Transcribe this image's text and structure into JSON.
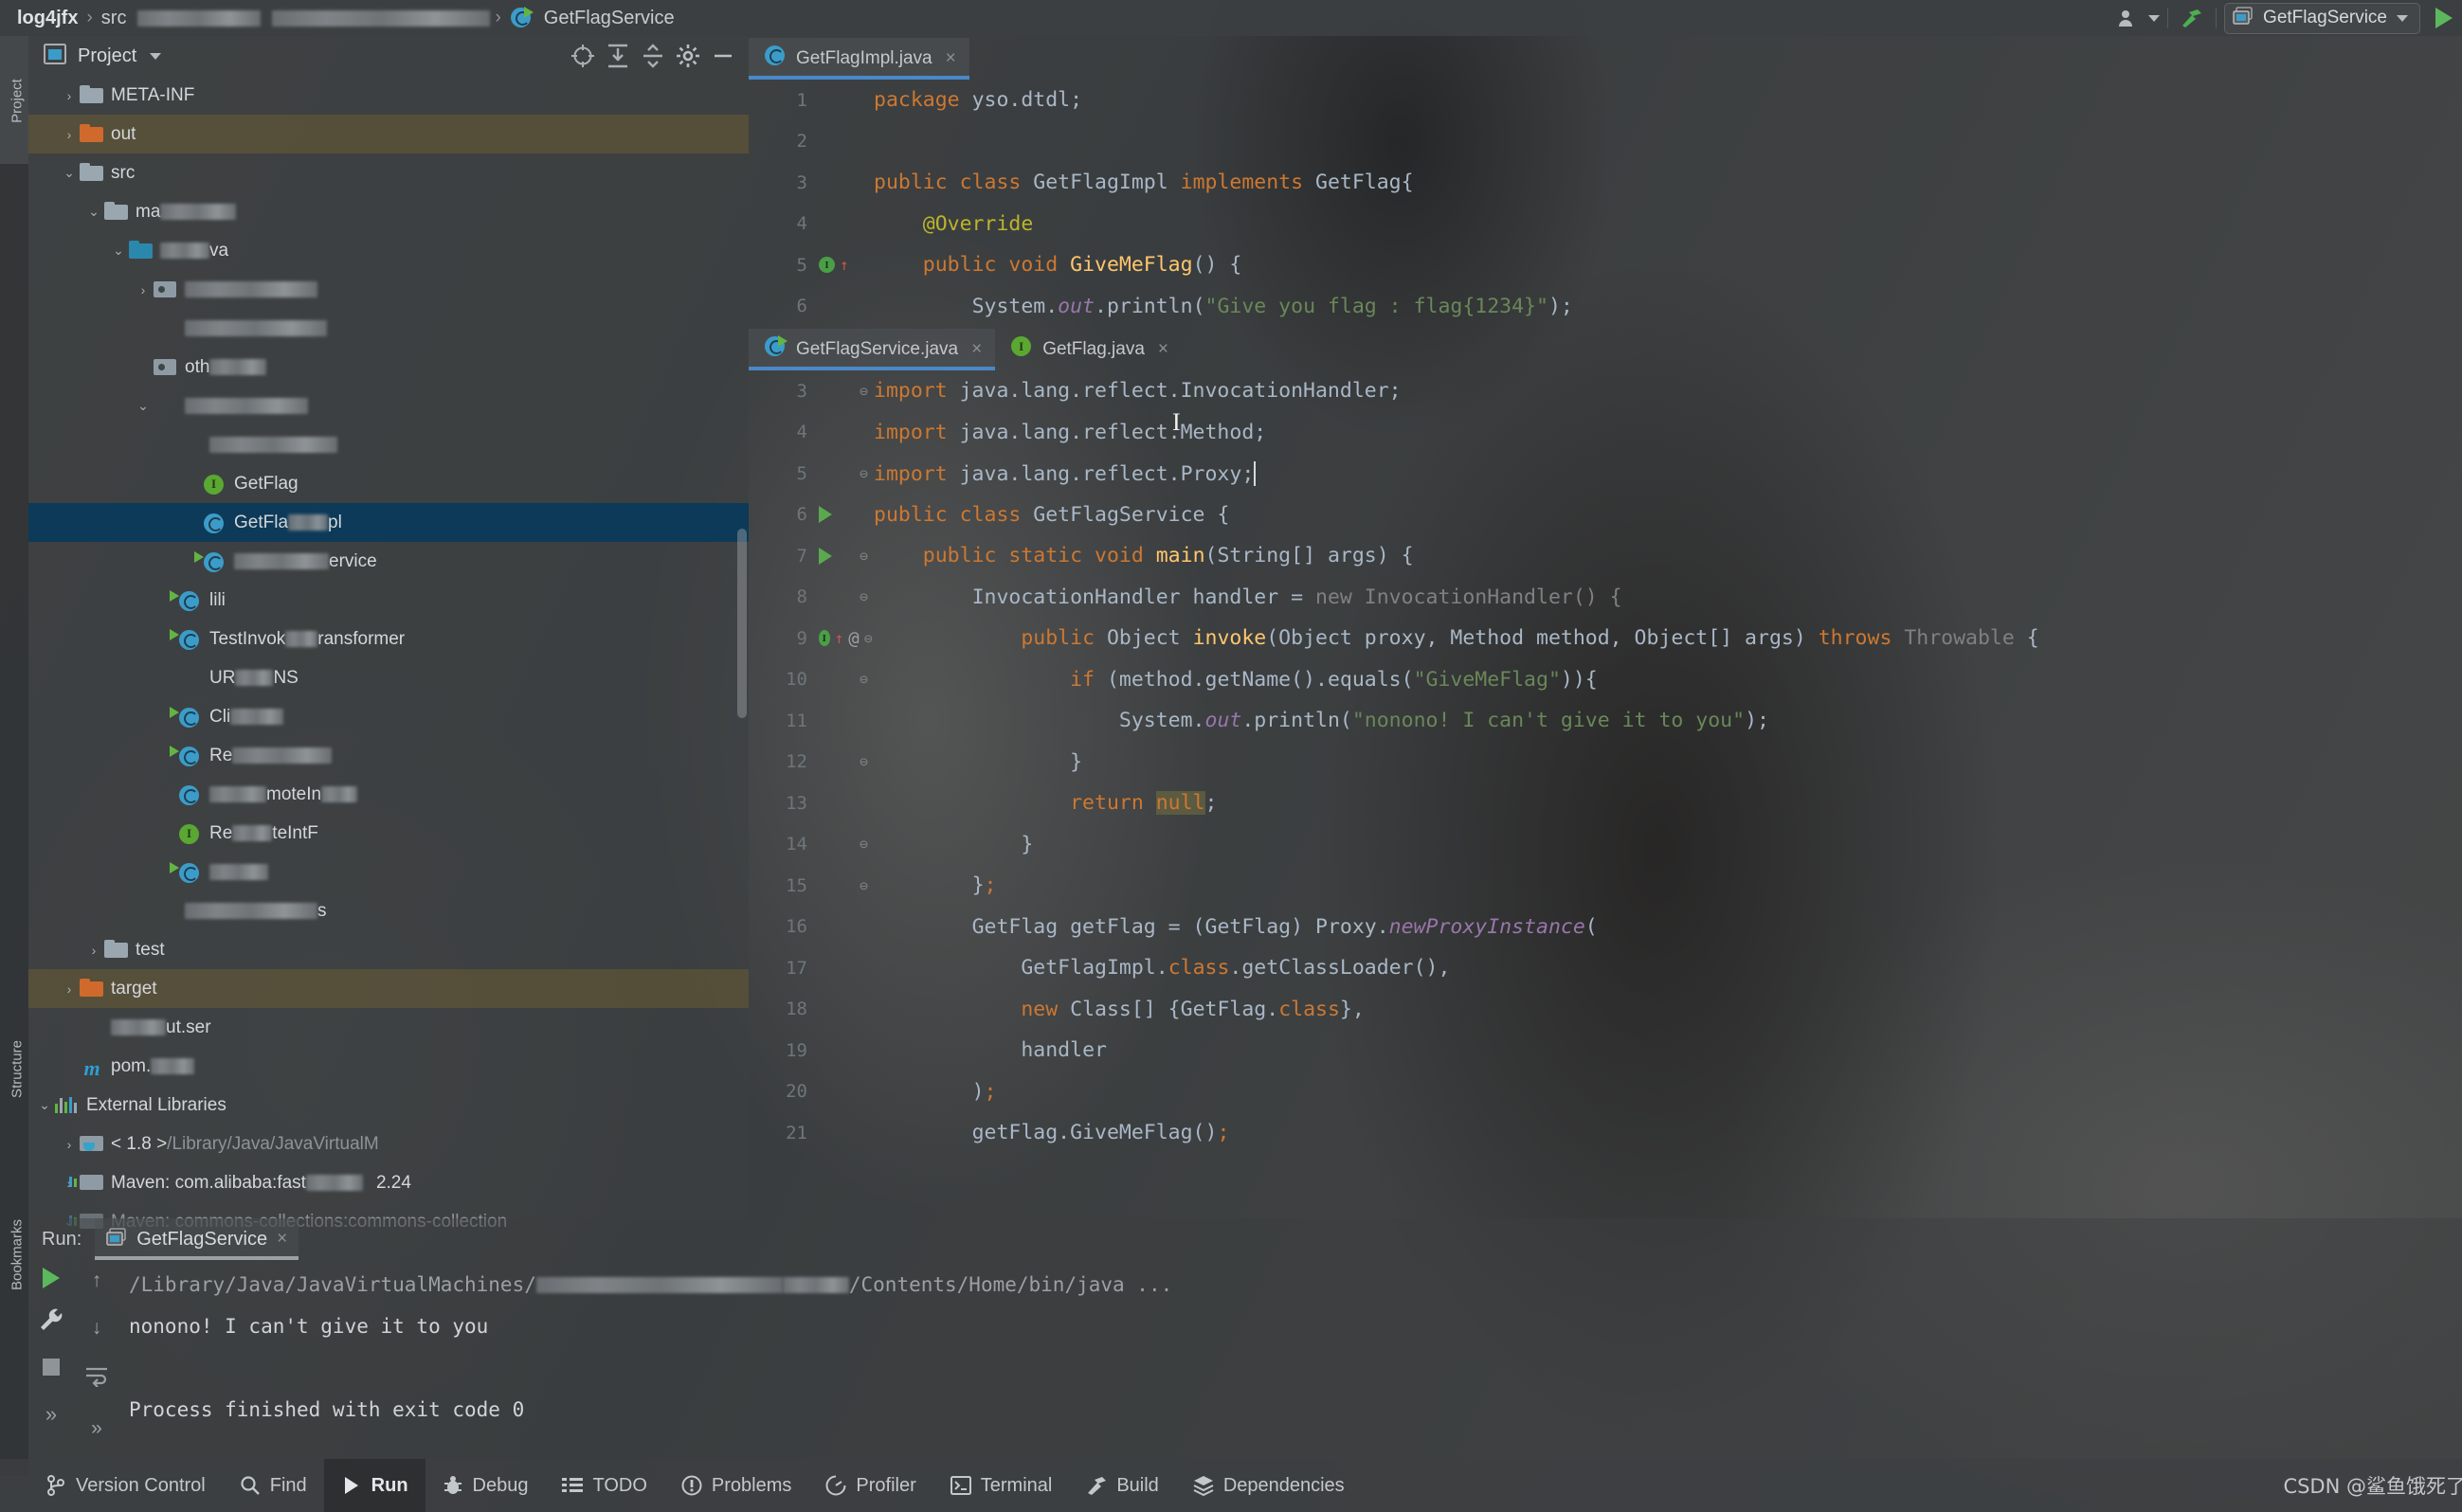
{
  "breadcrumbs": {
    "project": "log4jfx",
    "src": "src",
    "redacted_1": "",
    "redacted_2": "",
    "class_name": "GetFlagService",
    "separator": "›"
  },
  "toolbar_right": {
    "account_icon": "user-icon",
    "build_icon": "hammer-icon",
    "run_config_name": "GetFlagService",
    "run_icon": "run-triangle-icon"
  },
  "left_tool_strips": {
    "project_label": "Project",
    "structure_label": "Structure",
    "bookmarks_label": "Bookmarks"
  },
  "project_panel": {
    "title": "Project",
    "dropdown_icon": "chevron-down-icon",
    "header_icons": [
      "locate-icon",
      "expand-all-icon",
      "collapse-all-icon",
      "gear-icon",
      "minimize-icon"
    ],
    "tree": [
      {
        "label": "META-INF",
        "arrow": "›",
        "icon": "folder",
        "indent": 1,
        "state": "normal"
      },
      {
        "label": "out",
        "arrow": "›",
        "icon": "folder-orange",
        "indent": 1,
        "state": "highlight"
      },
      {
        "label": "src",
        "arrow": "⌄",
        "icon": "folder",
        "indent": 1,
        "state": "normal"
      },
      {
        "label": "ma",
        "arrow": "⌄",
        "icon": "folder",
        "indent": 2,
        "state": "normal",
        "redact_after": 80
      },
      {
        "label": "va",
        "arrow": "⌄",
        "icon": "folder-blue",
        "indent": 3,
        "state": "normal",
        "redact_before": 52
      },
      {
        "label": "",
        "arrow": "›",
        "icon": "package",
        "indent": 4,
        "state": "normal",
        "redact_after": 140
      },
      {
        "label": "",
        "arrow": "",
        "icon": "none",
        "indent": 4,
        "state": "normal",
        "redact_after": 150
      },
      {
        "label": "oth",
        "arrow": "",
        "icon": "package",
        "indent": 4,
        "state": "normal",
        "redact_after": 60
      },
      {
        "label": "",
        "arrow": "⌄",
        "icon": "none",
        "indent": 4,
        "state": "normal",
        "redact_after": 130
      },
      {
        "label": "",
        "arrow": "",
        "icon": "none",
        "indent": 5,
        "state": "normal",
        "redact_after": 135
      },
      {
        "label": "GetFlag",
        "arrow": "",
        "icon": "interface",
        "indent": 6,
        "state": "normal"
      },
      {
        "label": "GetFla",
        "arrow": "",
        "icon": "class",
        "indent": 6,
        "state": "selected",
        "suffix": "pl",
        "redact_mid": 42
      },
      {
        "label": "",
        "arrow": "",
        "icon": "class-run",
        "indent": 6,
        "state": "normal",
        "suffix": "ervice",
        "redact_mid": 100
      },
      {
        "label": "lili",
        "arrow": "",
        "icon": "class-run",
        "indent": 5,
        "state": "normal"
      },
      {
        "label": "TestInvok",
        "arrow": "",
        "icon": "class-run",
        "indent": 5,
        "state": "normal",
        "suffix": "ransformer",
        "redact_mid": 34
      },
      {
        "label": "UR",
        "arrow": "",
        "icon": "none",
        "indent": 5,
        "state": "normal",
        "suffix": "NS",
        "redact_mid": 40
      },
      {
        "label": "Cli",
        "arrow": "",
        "icon": "class-run",
        "indent": 5,
        "state": "normal",
        "redact_after": 56
      },
      {
        "label": "Re",
        "arrow": "",
        "icon": "class-run",
        "indent": 5,
        "state": "normal",
        "redact_after": 105
      },
      {
        "label": "moteIn",
        "arrow": "",
        "icon": "class",
        "indent": 5,
        "state": "normal",
        "redact_before": 60,
        "redact_after": 38
      },
      {
        "label": "Re",
        "arrow": "",
        "icon": "interface-sm",
        "indent": 5,
        "state": "normal",
        "suffix": "teIntF",
        "redact_mid": 42
      },
      {
        "label": "",
        "arrow": "",
        "icon": "class-run",
        "indent": 5,
        "state": "normal",
        "redact_after": 62
      },
      {
        "label": "s",
        "arrow": "",
        "icon": "none",
        "indent": 4,
        "state": "normal",
        "redact_before": 140
      },
      {
        "label": "test",
        "arrow": "›",
        "icon": "folder",
        "indent": 2,
        "state": "normal"
      },
      {
        "label": "target",
        "arrow": "›",
        "icon": "folder-orange",
        "indent": 1,
        "state": "highlight"
      },
      {
        "label": "ut.ser",
        "arrow": "",
        "icon": "none",
        "indent": 1,
        "state": "normal",
        "redact_before": 58
      },
      {
        "label": "pom.",
        "arrow": "",
        "icon": "maven",
        "indent": 1,
        "state": "normal",
        "redact_after": 46
      },
      {
        "label": "External Libraries",
        "arrow": "⌄",
        "icon": "bars",
        "indent": 0,
        "state": "normal"
      },
      {
        "label": "< 1.8 >",
        "arrow": "›",
        "icon": "jdk",
        "indent": 1,
        "state": "normal",
        "dim_suffix": "/Library/Java/JavaVirtualM"
      },
      {
        "label": "Maven: com.alibaba:fast",
        "arrow": "›",
        "icon": "lib",
        "indent": 1,
        "state": "normal",
        "suffix": "2.24",
        "redact_mid": 60
      },
      {
        "label": "Maven: commons-collections:commons-collection",
        "arrow": "⌄",
        "icon": "lib",
        "indent": 1,
        "state": "normal",
        "clipped": true
      }
    ]
  },
  "editor_top": {
    "tabs": [
      {
        "label": "GetFlagImpl.java",
        "icon": "class-icon",
        "active": true,
        "close": "×"
      }
    ],
    "lines": [
      {
        "num": "1",
        "segments": [
          {
            "t": "package ",
            "c": "kw"
          },
          {
            "t": "yso.dtdl;",
            "c": "plain"
          }
        ],
        "indent": 0
      },
      {
        "num": "2",
        "segments": [],
        "indent": 0
      },
      {
        "num": "3",
        "segments": [
          {
            "t": "public class ",
            "c": "kw"
          },
          {
            "t": "GetFlagImpl ",
            "c": "plain"
          },
          {
            "t": "implements ",
            "c": "kw"
          },
          {
            "t": "GetFlag{",
            "c": "plain"
          }
        ],
        "indent": 0
      },
      {
        "num": "4",
        "segments": [
          {
            "t": "@Override",
            "c": "anno"
          }
        ],
        "indent": 1
      },
      {
        "num": "5",
        "segments": [
          {
            "t": "public void ",
            "c": "kw"
          },
          {
            "t": "GiveMeFlag",
            "c": "mname"
          },
          {
            "t": "() {",
            "c": "plain"
          }
        ],
        "indent": 1,
        "gutter_mark": "impl-bulb"
      },
      {
        "num": "6",
        "segments": [
          {
            "t": "System.",
            "c": "plain"
          },
          {
            "t": "out",
            "c": "stat"
          },
          {
            "t": ".println(",
            "c": "plain"
          },
          {
            "t": "\"Give you flag : flag{1234}\"",
            "c": "str"
          },
          {
            "t": ");",
            "c": "plain"
          }
        ],
        "indent": 2
      }
    ]
  },
  "editor_main": {
    "tabs": [
      {
        "label": "GetFlagService.java",
        "icon": "class-run-icon",
        "active": true,
        "close": "×"
      },
      {
        "label": "GetFlag.java",
        "icon": "interface-icon",
        "active": false,
        "close": "×"
      }
    ],
    "lines": [
      {
        "num": "3",
        "segments": [
          {
            "t": "import ",
            "c": "kw"
          },
          {
            "t": "java.lang.reflect.InvocationHandler;",
            "c": "plain"
          }
        ],
        "indent": 0,
        "fold": "minus"
      },
      {
        "num": "4",
        "segments": [
          {
            "t": "import ",
            "c": "kw"
          },
          {
            "t": "java.lang.reflect.Method;",
            "c": "plain"
          }
        ],
        "indent": 0
      },
      {
        "num": "5",
        "segments": [
          {
            "t": "import ",
            "c": "kw"
          },
          {
            "t": "java.lang.reflect.Proxy;",
            "c": "plain"
          }
        ],
        "indent": 0,
        "fold": "minus",
        "caret": true
      },
      {
        "num": "6",
        "segments": [
          {
            "t": "public class ",
            "c": "kw"
          },
          {
            "t": "GetFlagService {",
            "c": "plain"
          }
        ],
        "indent": 0,
        "gutter_mark": "run"
      },
      {
        "num": "7",
        "segments": [
          {
            "t": "public static void ",
            "c": "kw"
          },
          {
            "t": "main",
            "c": "mname"
          },
          {
            "t": "(String[] args) {",
            "c": "plain"
          }
        ],
        "indent": 1,
        "gutter_mark": "run",
        "fold": "minus"
      },
      {
        "num": "8",
        "segments": [
          {
            "t": "InvocationHandler handler = ",
            "c": "plain"
          },
          {
            "t": "new InvocationHandler() {",
            "c": "faded"
          }
        ],
        "indent": 2,
        "fold": "minus"
      },
      {
        "num": "9",
        "segments": [
          {
            "t": "public ",
            "c": "kw"
          },
          {
            "t": "Object ",
            "c": "plain"
          },
          {
            "t": "invoke",
            "c": "mname"
          },
          {
            "t": "(Object proxy, Method method, Object[] args) ",
            "c": "plain"
          },
          {
            "t": "throws ",
            "c": "kw"
          },
          {
            "t": "Throwable",
            "c": "faded"
          },
          {
            "t": " {",
            "c": "plain"
          }
        ],
        "indent": 3,
        "gutter_mark": "impl-bulb-at",
        "fold": "minus"
      },
      {
        "num": "10",
        "segments": [
          {
            "t": "if ",
            "c": "kw"
          },
          {
            "t": "(method.getName().equals(",
            "c": "plain"
          },
          {
            "t": "\"GiveMeFlag\"",
            "c": "str"
          },
          {
            "t": ")){",
            "c": "plain"
          }
        ],
        "indent": 4,
        "fold": "minus"
      },
      {
        "num": "11",
        "segments": [
          {
            "t": "System.",
            "c": "plain"
          },
          {
            "t": "out",
            "c": "stat"
          },
          {
            "t": ".println(",
            "c": "plain"
          },
          {
            "t": "\"nonono! I can't give it to you\"",
            "c": "str"
          },
          {
            "t": ");",
            "c": "plain"
          }
        ],
        "indent": 5
      },
      {
        "num": "12",
        "segments": [
          {
            "t": "}",
            "c": "plain"
          }
        ],
        "indent": 4,
        "fold": "minus"
      },
      {
        "num": "13",
        "segments": [
          {
            "t": "return ",
            "c": "kw"
          },
          {
            "t": "null",
            "c": "kw-hl"
          },
          {
            "t": ";",
            "c": "plain"
          }
        ],
        "indent": 4
      },
      {
        "num": "14",
        "segments": [
          {
            "t": "}",
            "c": "plain"
          }
        ],
        "indent": 3,
        "fold": "minus"
      },
      {
        "num": "15",
        "segments": [
          {
            "t": "}",
            "c": "plain"
          },
          {
            "t": ";",
            "c": "kw"
          }
        ],
        "indent": 2,
        "fold": "minus"
      },
      {
        "num": "16",
        "segments": [
          {
            "t": "GetFlag getFlag = (GetFlag) Proxy.",
            "c": "plain"
          },
          {
            "t": "newProxyInstance",
            "c": "stat"
          },
          {
            "t": "(",
            "c": "plain"
          }
        ],
        "indent": 2
      },
      {
        "num": "17",
        "segments": [
          {
            "t": "GetFlagImpl.",
            "c": "plain"
          },
          {
            "t": "class",
            "c": "kw"
          },
          {
            "t": ".getClassLoader(),",
            "c": "plain"
          }
        ],
        "indent": 3
      },
      {
        "num": "18",
        "segments": [
          {
            "t": "new ",
            "c": "kw"
          },
          {
            "t": "Class[] {GetFlag.",
            "c": "plain"
          },
          {
            "t": "class",
            "c": "kw"
          },
          {
            "t": "},",
            "c": "plain"
          }
        ],
        "indent": 3
      },
      {
        "num": "19",
        "segments": [
          {
            "t": "handler",
            "c": "plain"
          }
        ],
        "indent": 3
      },
      {
        "num": "20",
        "segments": [
          {
            "t": ")",
            "c": "plain"
          },
          {
            "t": ";",
            "c": "kw"
          }
        ],
        "indent": 2
      },
      {
        "num": "21",
        "segments": [
          {
            "t": "getFlag.GiveMeFlag()",
            "c": "plain"
          },
          {
            "t": ";",
            "c": "kw"
          }
        ],
        "indent": 2
      }
    ]
  },
  "run_panel": {
    "label": "Run:",
    "tab_label": "GetFlagService",
    "tab_close": "×",
    "tab_icon": "run-config-icon",
    "buttons": [
      "run-icon",
      "wrench-icon",
      "stop-icon",
      "up-arrow-icon",
      "down-arrow-icon",
      "soft-wrap-icon",
      "more-icon"
    ],
    "console": [
      {
        "text": "/Library/Java/JavaVirtualMachines/",
        "type": "path",
        "redact_after": 260,
        "suffix": "/Contents/Home/bin/java ...",
        "redact_mid": 70
      },
      {
        "text": "nonono! I can't give it to you",
        "type": "out"
      },
      {
        "text": "",
        "type": "out"
      },
      {
        "text": "Process finished with exit code 0",
        "type": "out"
      }
    ]
  },
  "status_bar": {
    "items": [
      {
        "label": "Version Control",
        "icon": "branch-icon",
        "active": false
      },
      {
        "label": "Find",
        "icon": "search-icon",
        "active": false
      },
      {
        "label": "Run",
        "icon": "run-triangle-icon",
        "active": true
      },
      {
        "label": "Debug",
        "icon": "bug-icon",
        "active": false
      },
      {
        "label": "TODO",
        "icon": "list-icon",
        "active": false
      },
      {
        "label": "Problems",
        "icon": "warning-icon",
        "active": false
      },
      {
        "label": "Profiler",
        "icon": "profiler-icon",
        "active": false
      },
      {
        "label": "Terminal",
        "icon": "terminal-icon",
        "active": false
      },
      {
        "label": "Build",
        "icon": "hammer-icon",
        "active": false
      },
      {
        "label": "Dependencies",
        "icon": "layers-icon",
        "active": false
      }
    ],
    "watermark": "CSDN @鲨鱼饿死了"
  },
  "colors": {
    "accent_blue": "#4a88c7",
    "selection_blue": "#0d3a58",
    "keyword_orange": "#cc7832",
    "string_green": "#6a8759",
    "method_yellow": "#ffc66d",
    "static_purple": "#9876aa",
    "run_green": "#5cb85c",
    "folder_orange": "#cf6a2c"
  }
}
